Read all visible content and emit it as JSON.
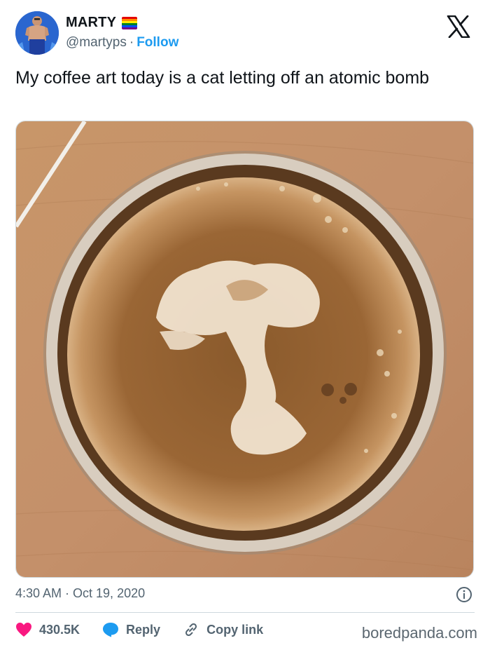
{
  "author": {
    "display_name": "MARTY",
    "handle": "@martyps",
    "separator": "·",
    "follow_label": "Follow",
    "avatar_icon": "profile-photo",
    "name_badge_icon": "rainbow-flag-icon"
  },
  "header": {
    "logo_icon": "x-logo-icon"
  },
  "tweet": {
    "text": "My coffee art today is a cat letting off an atomic bomb",
    "image_icon": "coffee-latte-art-photo",
    "timestamp": "4:30 AM · Oct 19, 2020",
    "info_icon": "info-icon"
  },
  "actions": {
    "likes": "430.5K",
    "reply_label": "Reply",
    "copy_link_label": "Copy link",
    "like_color": "#f91880",
    "reply_color": "#1d9bf0",
    "link_color": "#536471"
  },
  "watermark": "boredpanda.com",
  "colors": {
    "accent": "#1d9bf0",
    "secondary_text": "#536471",
    "border": "#cfd9de"
  }
}
